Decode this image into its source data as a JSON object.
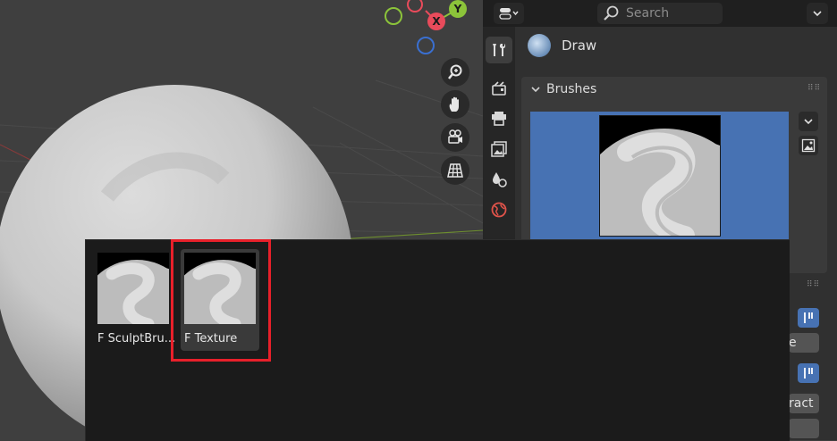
{
  "header": {
    "search_placeholder": "Search"
  },
  "tool": {
    "name": "Draw"
  },
  "brushes_panel": {
    "title": "Brushes"
  },
  "brush_popup": {
    "items": [
      {
        "label": "F SculptBru..."
      },
      {
        "label": "F Texture"
      }
    ]
  },
  "partial_labels": {
    "frag_1": "e",
    "frag_2": "ract"
  },
  "gizmo_labels": {
    "x_axis": "X",
    "y_axis": "Y"
  },
  "colors": {
    "selection_blue": "#4772b3",
    "highlight_red": "#e8202a",
    "axis_x": "#e94b5b",
    "axis_y": "#8cc43a",
    "axis_z": "#3a6fd0"
  },
  "icons": [
    "zoom-icon",
    "hand-pan-icon",
    "camera-icon",
    "grid-view-icon",
    "tool-icon",
    "render-icon",
    "output-icon",
    "view-layer-icon",
    "scene-icon",
    "world-icon",
    "search-icon",
    "editor-type-icon",
    "chevron-down-icon",
    "image-icon"
  ]
}
